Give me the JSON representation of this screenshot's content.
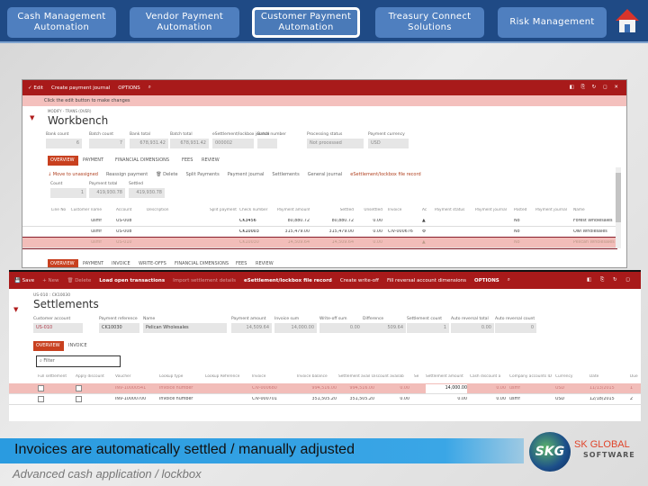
{
  "nav": {
    "items": [
      {
        "label": "Cash Management Automation"
      },
      {
        "label": "Vendor  Payment Automation"
      },
      {
        "label": "Customer Payment Automation",
        "active": true
      },
      {
        "label": "Treasury Connect Solutions"
      },
      {
        "label": "Risk Management"
      }
    ],
    "home_icon": "home-icon"
  },
  "workbench": {
    "toolbar": {
      "edit": "✓ Edit",
      "create": "Create payment journal",
      "options": "OPTIONS",
      "search": "⌕",
      "right_icons": "◧ ⎘ ↻ ◻ ✕"
    },
    "notice": "Click the edit button to make changes",
    "breadcrumb": "MODIFY - TRANS (OVER)",
    "title": "Workbench",
    "fields": [
      {
        "label": "Bank count",
        "value": "6"
      },
      {
        "label": "Batch count",
        "value": "7"
      },
      {
        "label": "Bank total",
        "value": "678,931.42"
      },
      {
        "label": "Batch total",
        "value": "678,931.42"
      },
      {
        "label": "eSettlement/lockbox journal",
        "value": "000002"
      },
      {
        "label": "Batch number",
        "value": ""
      },
      {
        "label": "Processing status",
        "value": "Not processed"
      },
      {
        "label": "Payment currency",
        "value": "USD"
      }
    ],
    "tabs": [
      "OVERVIEW",
      "PAYMENT",
      "FINANCIAL DIMENSIONS",
      "FEES",
      "REVIEW"
    ],
    "actions": [
      "↓ Move to unassigned",
      "Reassign payment",
      "🗑 Delete",
      "Split Payments",
      "Payment journal",
      "Settlements",
      "General journal",
      "eSettlement/lockbox file record"
    ],
    "summary": [
      {
        "label": "Count",
        "value": "1"
      },
      {
        "label": "Payment total",
        "value": "419,930.78"
      },
      {
        "label": "Settled",
        "value": "419,930.78"
      }
    ],
    "table": {
      "headers": [
        "Line No",
        "Customer name",
        "Account",
        "Description",
        "Split payment",
        "Check number",
        "Payment amount",
        "Settled",
        "Unsettled",
        "Invoice",
        "Ac",
        "Payment status",
        "Payment journal",
        "Posted",
        "Payment journal",
        "Name"
      ],
      "rows": [
        [
          "",
          "usmf",
          "US-008",
          "",
          "",
          "CK3456",
          "80,880.72",
          "80,880.72",
          "0.00",
          "",
          "▲",
          "",
          "",
          "No",
          "",
          "Forest Wholesales"
        ],
        [
          "",
          "usmf",
          "US-008",
          "",
          "",
          "CK10003",
          "315,479.00",
          "315,479.00",
          "0.00",
          "CIV-000676",
          "⚙",
          "",
          "",
          "No",
          "",
          "Owl Wholesales"
        ],
        [
          "",
          "usmf",
          "US-010",
          "",
          "",
          "CK10030",
          "14,509.64",
          "14,509.64",
          "0.00",
          "",
          "▲",
          "",
          "",
          "No",
          "",
          "Pelican Wholesales"
        ]
      ]
    },
    "tabs2": [
      "OVERVIEW",
      "PAYMENT",
      "INVOICE",
      "WRITE-OFFS",
      "FINANCIAL DIMENSIONS",
      "FEES",
      "REVIEW"
    ]
  },
  "settlements": {
    "toolbar": [
      "💾 Save",
      "+ New",
      "🗑 Delete",
      "Load open transactions",
      "Import settlement details",
      "eSettlement/lockbox file record",
      "Create write-off",
      "Fill reversal account dimensions",
      "OPTIONS",
      "⌕"
    ],
    "right_icons": "◧ ⎘ ↻ ◻",
    "breadcrumb": "US-010 : CK10030",
    "title": "Settlements",
    "fields": [
      {
        "label": "Customer account",
        "value": "US-010"
      },
      {
        "label": "Payment reference",
        "value": "CK10030"
      },
      {
        "label": "Name",
        "value": "Pelican Wholesales"
      },
      {
        "label": "Payment amount",
        "value": "14,509.64"
      },
      {
        "label": "Invoice sum",
        "value": "14,000.00"
      },
      {
        "label": "Write-off sum",
        "value": "0.00"
      },
      {
        "label": "Difference",
        "value": "509.64"
      },
      {
        "label": "Settlement count",
        "value": "1"
      },
      {
        "label": "Auto reversal total",
        "value": "0.00"
      },
      {
        "label": "Auto reversal count",
        "value": "0"
      }
    ],
    "tabs": [
      "OVERVIEW",
      "INVOICE"
    ],
    "filter_placeholder": "⌕ Filter",
    "table": {
      "headers": [
        "Full settlement",
        "Apply discount",
        "Voucher",
        "Lookup type",
        "Lookup Reference",
        "Invoice",
        "Invoice balance",
        "Settlement avail",
        "Discount availab",
        "Se",
        "Settlement amount",
        "Cash discount a",
        "Company accounts ID",
        "Currency",
        "Date",
        "Due"
      ],
      "rows": [
        [
          "",
          "",
          "INV-10000541",
          "Invoice number",
          "",
          "CIV-000680",
          "994,516.00",
          "994,516.00",
          "0.00",
          "",
          "14,000.00",
          "0.00",
          "usmf",
          "USD",
          "11/13/2015",
          "1"
        ],
        [
          "",
          "",
          "INV-10000700",
          "Invoice number",
          "",
          "CIV-000701",
          "351,505.20",
          "351,505.20",
          "0.00",
          "",
          "0.00",
          "0.00",
          "usmf",
          "USD",
          "12/18/2015",
          "2"
        ]
      ]
    }
  },
  "footer": {
    "headline": "Invoices are automatically settled / manually adjusted",
    "subtitle": "Advanced cash application / lockbox",
    "logo_text": "SKG",
    "brand_line1": "SK GLOBAL",
    "brand_line2": "SOFTWARE"
  }
}
